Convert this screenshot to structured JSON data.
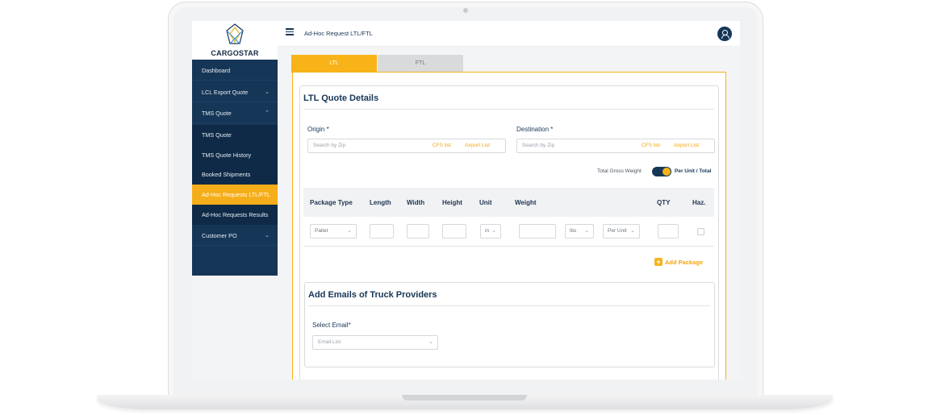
{
  "app": {
    "brand_name": "CARGOSTAR",
    "page_title": "Ad-Hoc Request LTL/FTL"
  },
  "sidebar": {
    "items": [
      {
        "label": "Dashboard"
      },
      {
        "label": "LCL Export Quote"
      },
      {
        "label": "TMS Quote"
      },
      {
        "label": "TMS Quote"
      },
      {
        "label": "TMS Quote History"
      },
      {
        "label": "Booked Shipments"
      },
      {
        "label": "Ad-Hoc Requests LTL/FTL"
      },
      {
        "label": "Ad-Hoc Requests Results"
      },
      {
        "label": "Customer PO"
      }
    ]
  },
  "tabs": [
    {
      "label": "LTL"
    },
    {
      "label": "FTL"
    }
  ],
  "quote": {
    "title": "LTL Quote Details",
    "origin_label": "Origin *",
    "destination_label": "Destination *",
    "search_placeholder": "Search by Zip",
    "cfs_link": "CFS list",
    "airport_link": "Airport List",
    "toggle_left": "Total Gross Weight",
    "toggle_right": "Per Unit / Total"
  },
  "table": {
    "headers": [
      "Package Type",
      "Length",
      "Width",
      "Height",
      "Unit",
      "Weight",
      "QTY",
      "Haz."
    ],
    "row": {
      "package_type": "Pallet",
      "unit": "in",
      "weight_unit": "lbs",
      "weight_mode": "Per Unit"
    }
  },
  "add_package_label": "Add Package",
  "emails": {
    "title": "Add Emails of Truck Providers",
    "select_label": "Select Email*",
    "placeholder": "Email List"
  },
  "colors": {
    "navy": "#163657",
    "accent": "#f7b318"
  },
  "icons": {
    "menu": "hamburger-icon",
    "user": "user-icon",
    "chevron": "chevron-icon",
    "add": "plus-icon"
  }
}
